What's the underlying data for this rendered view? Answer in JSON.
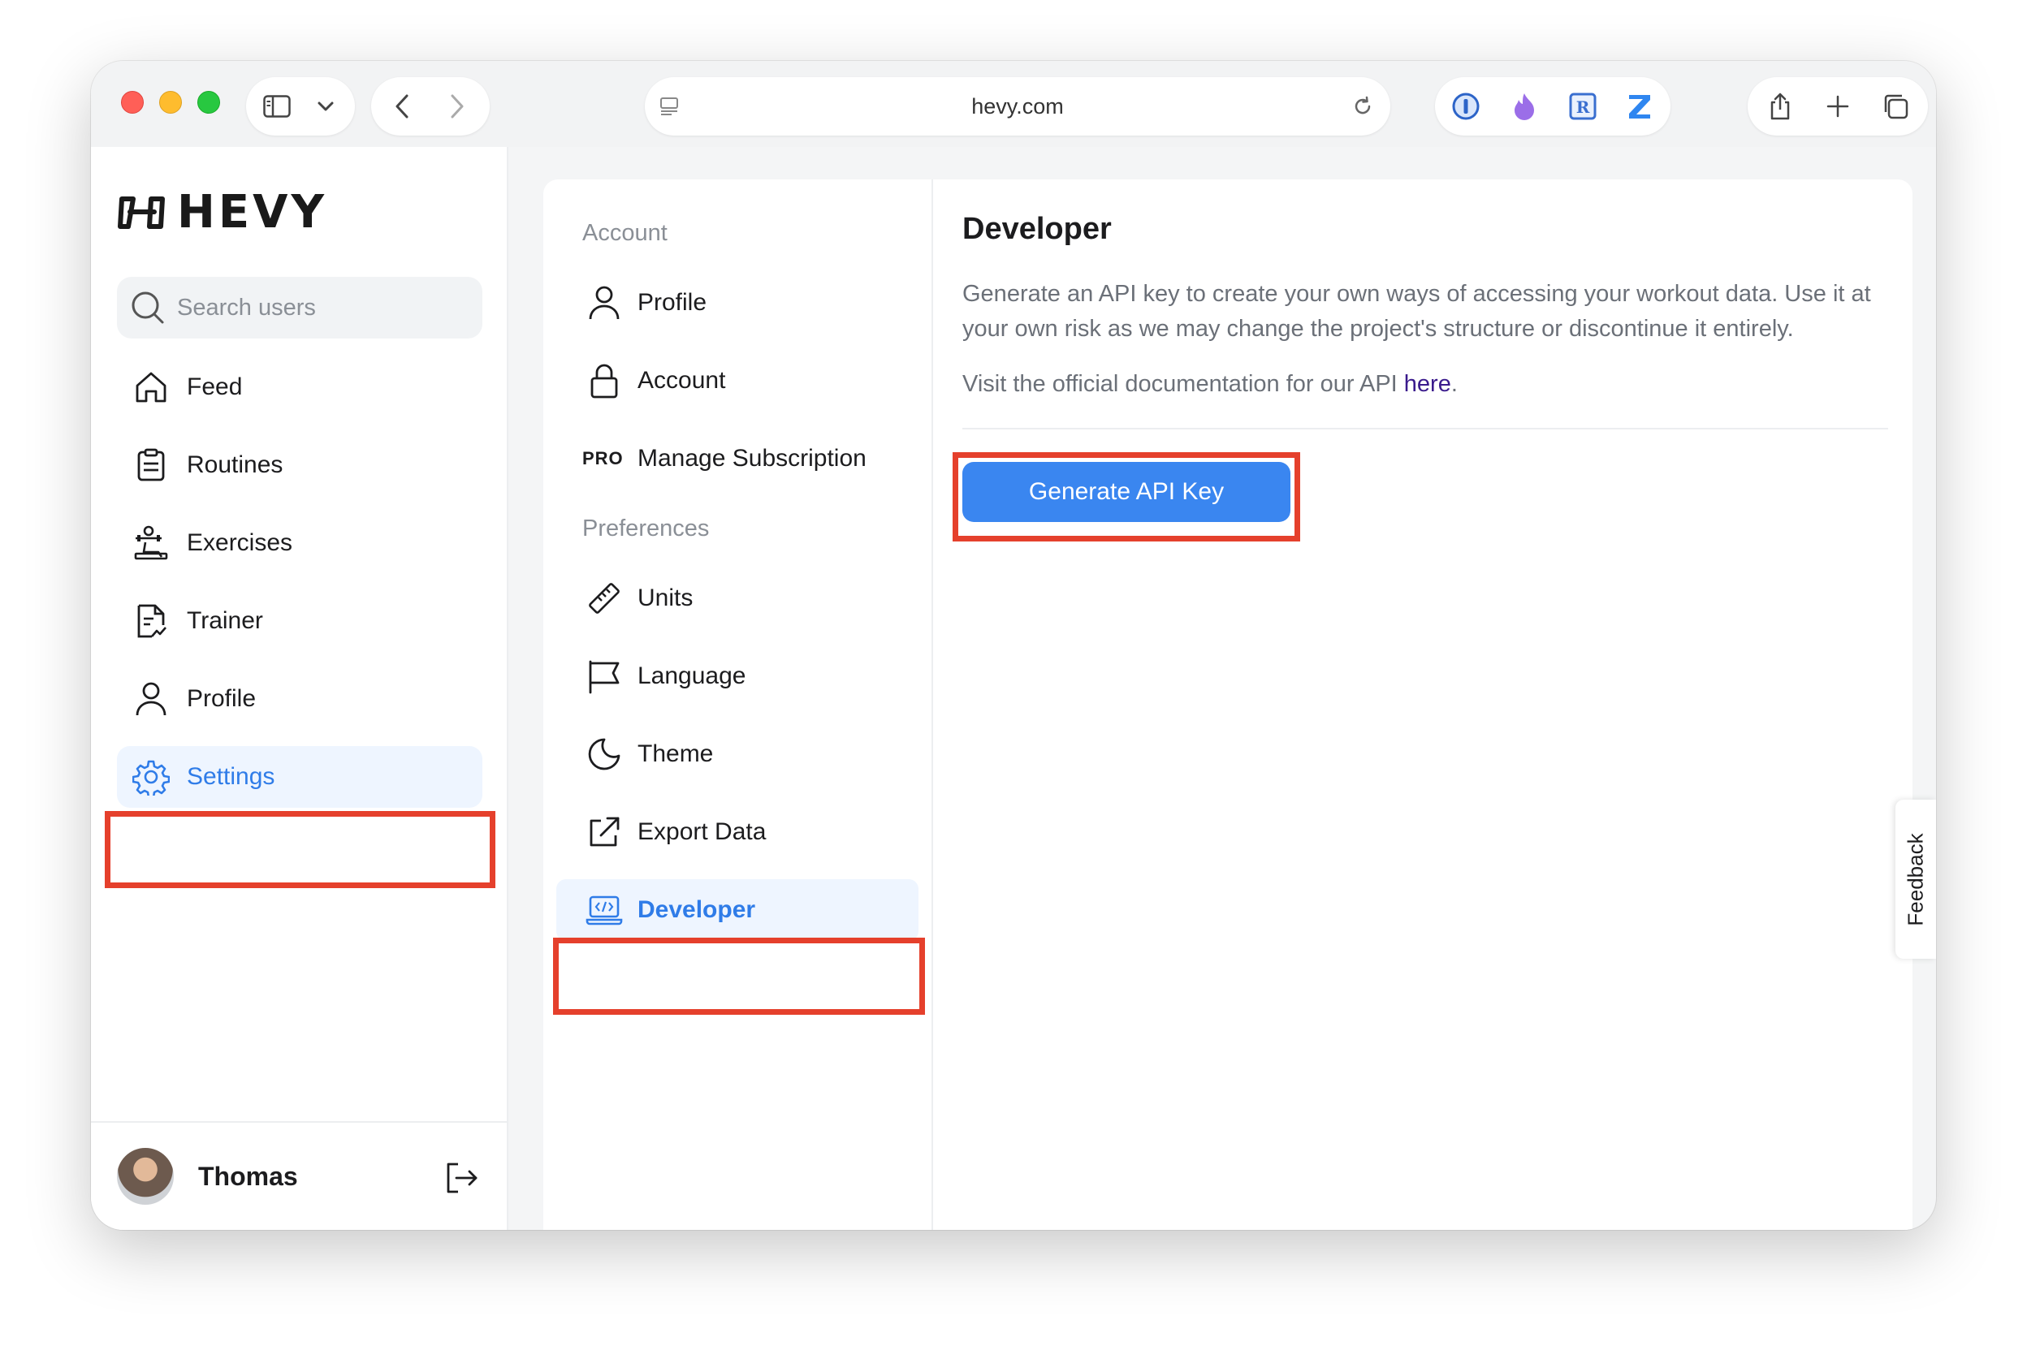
{
  "browser": {
    "url": "hevy.com"
  },
  "sidebar": {
    "brand": "HEVY",
    "search_placeholder": "Search users",
    "items": [
      {
        "label": "Feed"
      },
      {
        "label": "Routines"
      },
      {
        "label": "Exercises"
      },
      {
        "label": "Trainer"
      },
      {
        "label": "Profile"
      },
      {
        "label": "Settings"
      }
    ],
    "active_item": "Settings",
    "user_name": "Thomas"
  },
  "settings_menu": {
    "account_section": "Account",
    "account_items": [
      {
        "label": "Profile"
      },
      {
        "label": "Account"
      },
      {
        "label": "Manage Subscription",
        "badge": "PRO"
      }
    ],
    "preferences_section": "Preferences",
    "preference_items": [
      {
        "label": "Units"
      },
      {
        "label": "Language"
      },
      {
        "label": "Theme"
      },
      {
        "label": "Export Data"
      },
      {
        "label": "Developer"
      }
    ],
    "active_item": "Developer"
  },
  "developer": {
    "title": "Developer",
    "description": "Generate an API key to create your own ways of accessing your workout data. Use it at your own risk as we may change the project's structure or discontinue it entirely.",
    "docs_prefix": "Visit the official documentation for our API ",
    "docs_link": "here",
    "docs_suffix": ".",
    "generate_button": "Generate API Key"
  },
  "feedback_tab": "Feedback",
  "colors": {
    "accent": "#3a86f0",
    "active_bg": "#eef5ff",
    "highlight": "#e5402c"
  }
}
